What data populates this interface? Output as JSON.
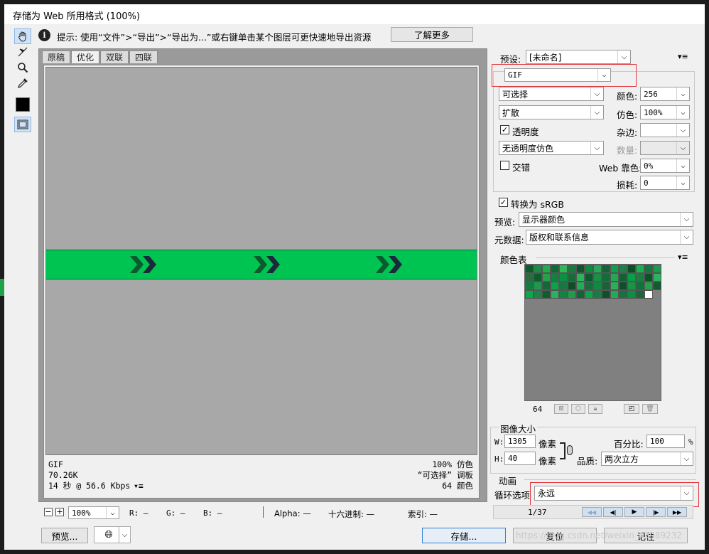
{
  "window": {
    "title": "存储为 Web 所用格式 (100%)"
  },
  "hint": {
    "text": "提示: 使用“文件”>“导出”>“导出为...”或右键单击某个图层可更快速地导出资源",
    "learn_more": "了解更多"
  },
  "tools": [
    "hand-tool-icon",
    "slice-select-tool-icon",
    "zoom-tool-icon",
    "eyedropper-tool-icon",
    "eyedropper-color-swatch",
    "toggle-slices-icon"
  ],
  "tabs": [
    "原稿",
    "优化",
    "双联",
    "四联"
  ],
  "active_tab": "优化",
  "preview": {
    "format": "GIF",
    "size": "70.26K",
    "time": "14 秒 @ 56.6 Kbps",
    "dither": "100% 仿色",
    "palette": "“可选择” 调板",
    "colors": "64 颜色",
    "colors_bg": "#a8a8a8",
    "banner_color": "#00c452"
  },
  "status_bar": {
    "zoom": "100%",
    "r": "R: —",
    "g": "G: —",
    "b": "B: —",
    "alpha": "Alpha: —",
    "hex": "十六进制: —",
    "index": "索引: —"
  },
  "settings": {
    "preset_label": "预设:",
    "preset_value": "[未命名]",
    "format": "GIF",
    "reduction": "可选择",
    "colors_label": "颜色:",
    "colors_value": "256",
    "dither_algo": "扩散",
    "dither_label": "仿色:",
    "dither_value": "100%",
    "transparency_label": "透明度",
    "matte_label": "杂边:",
    "transparency_dither": "无透明度仿色",
    "amount_label": "数量:",
    "interlaced_label": "交错",
    "websnap_label": "Web 靠色:",
    "websnap_value": "0%",
    "lossy_label": "损耗:",
    "lossy_value": "0",
    "convert_srgb_label": "转换为 sRGB",
    "preview_label": "预览:",
    "preview_value": "显示器颜色",
    "metadata_label": "元数据:",
    "metadata_value": "版权和联系信息"
  },
  "color_table": {
    "label": "颜色表",
    "count": "64",
    "swatches": [
      "#0d5a2e",
      "#1d8a45",
      "#23a94f",
      "#0f6b34",
      "#2fb85a",
      "#1a7a3d",
      "#14532a",
      "#0a8d3c",
      "#2aa55a",
      "#16633a",
      "#0ea04a",
      "#1f7f48",
      "#0c4f25",
      "#19b051",
      "#0f7a3a",
      "#1c9950",
      "#2a6b3f",
      "#0a5e2c",
      "#21a24b",
      "#128042",
      "#0b9144",
      "#186b38",
      "#26b75b",
      "#0e5a30",
      "#1a8f4a",
      "#0d6e36",
      "#23a852",
      "#145f33",
      "#08a046",
      "#1b7d43",
      "#0c5428",
      "#2bb45d",
      "#0f8040",
      "#1e9a4d",
      "#12683a",
      "#0aa349",
      "#197645",
      "#0e4d27",
      "#22ad55",
      "#166e3c",
      "#0d8b41",
      "#1b6037",
      "#27b058",
      "#104f2b",
      "#1a9446",
      "#0b7537",
      "#24a34f",
      "#135a31",
      "#09a84a",
      "#1d8447",
      "#0e5f2f",
      "#2cb15c",
      "#118343",
      "#1f9c4e",
      "#126534",
      "#0ca64a",
      "#1c7b44",
      "#0f502a",
      "#20ab56",
      "#177140",
      "#0e8e43",
      "#1a6739",
      "#ffffff"
    ]
  },
  "image_size": {
    "label": "图像大小",
    "w_label": "W:",
    "w_value": "1305",
    "h_label": "H:",
    "h_value": "40",
    "unit": "像素",
    "percent_label": "百分比:",
    "percent_value": "100",
    "percent_unit": "%",
    "quality_label": "品质:",
    "quality_value": "两次立方"
  },
  "animation": {
    "label": "动画",
    "loop_label": "循环选项",
    "loop_value": "永远",
    "frame": "1/37"
  },
  "buttons": {
    "preview": "预览...",
    "save": "存储...",
    "reset": "复位",
    "remember": "记住"
  },
  "watermark": "https://blog.csdn.net/weixin_43989232",
  "colors": {
    "highlight_red": "#e0353b",
    "primary_border": "#2d7fd6"
  }
}
